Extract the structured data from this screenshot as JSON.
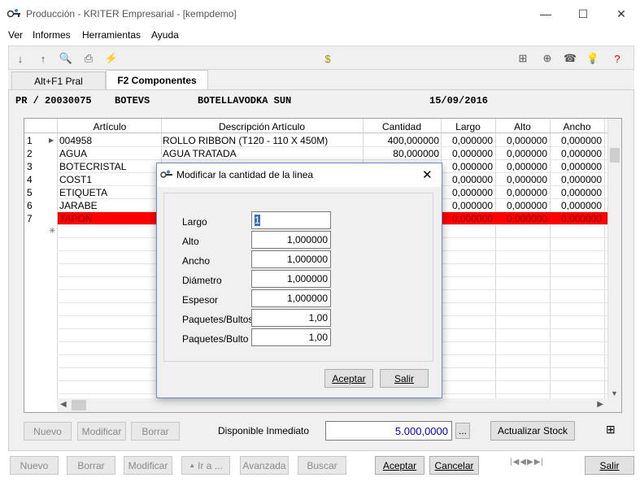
{
  "window": {
    "title": "Producción - KRITER Empresarial  - [kempdemo]",
    "minimize": "—",
    "maximize": "☐",
    "close": "✕"
  },
  "menu": [
    "Ver",
    "Informes",
    "Herramientas",
    "Ayuda"
  ],
  "tabs": [
    {
      "label": "Alt+F1 Pral"
    },
    {
      "label": "F2 Componentes"
    }
  ],
  "header": {
    "order": "PR / 20030075",
    "code": "BOTEVS",
    "name": "BOTELLAVODKA SUN",
    "date": "15/09/2016"
  },
  "grid": {
    "columns": [
      "Artículo",
      "Descripción Artículo",
      "Cantidad",
      "Largo",
      "Alto",
      "Ancho"
    ],
    "rows": [
      {
        "n": "1",
        "articulo": "004958",
        "desc": "ROLLO RIBBON (T120 - 110 X 450M)",
        "cantidad": "400,000000",
        "largo": "0,000000",
        "alto": "0,000000",
        "ancho": "0,000000"
      },
      {
        "n": "2",
        "articulo": "AGUA",
        "desc": "AGUA TRATADA",
        "cantidad": "80,000000",
        "largo": "0,000000",
        "alto": "0,000000",
        "ancho": "0,000000"
      },
      {
        "n": "3",
        "articulo": "BOTECRISTAL",
        "desc": "",
        "cantidad": "",
        "largo": "0,000000",
        "alto": "0,000000",
        "ancho": "0,000000"
      },
      {
        "n": "4",
        "articulo": "COST1",
        "desc": "",
        "cantidad": "",
        "largo": "0,000000",
        "alto": "0,000000",
        "ancho": "0,000000"
      },
      {
        "n": "5",
        "articulo": "ETIQUETA",
        "desc": "",
        "cantidad": "",
        "largo": "0,000000",
        "alto": "0,000000",
        "ancho": "0,000000"
      },
      {
        "n": "6",
        "articulo": "JARABE",
        "desc": "",
        "cantidad": "",
        "largo": "0,000000",
        "alto": "0,000000",
        "ancho": "0,000000"
      },
      {
        "n": "7",
        "articulo": "TAPON",
        "desc": "",
        "cantidad": "",
        "largo": "0,000000",
        "alto": "0,000000",
        "ancho": "0,000000"
      }
    ],
    "selected_row_color": "#ff0000"
  },
  "panel_buttons": {
    "nuevo": "Nuevo",
    "modificar": "Modificar",
    "borrar": "Borrar"
  },
  "disponible": {
    "label": "Disponible Inmediato",
    "value": "5.000,0000",
    "browse": "...",
    "actualizar": "Actualizar Stock"
  },
  "bottom_buttons": {
    "nuevo": "Nuevo",
    "borrar": "Borrar",
    "modificar": "Modificar",
    "ir_a": "Ir a ...",
    "avanzada": "Avanzada",
    "buscar": "Buscar",
    "aceptar": "Aceptar",
    "cancelar": "Cancelar",
    "salir": "Salir"
  },
  "dialog": {
    "title": "Modificar la cantidad de la linea",
    "close": "✕",
    "fields": [
      {
        "label": "Largo",
        "value": "1"
      },
      {
        "label": "Alto",
        "value": "1,000000"
      },
      {
        "label": "Ancho",
        "value": "1,000000"
      },
      {
        "label": "Diámetro",
        "value": "1,000000"
      },
      {
        "label": "Espesor",
        "value": "1,000000"
      },
      {
        "label": "Paquetes/Bultos",
        "value": "1,00"
      },
      {
        "label": "Paquetes/Bulto",
        "value": "1,00"
      }
    ],
    "aceptar": "Aceptar",
    "salir": "Salir"
  }
}
